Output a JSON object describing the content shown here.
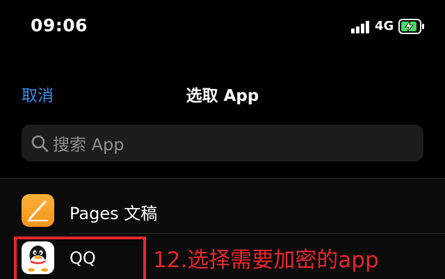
{
  "status_bar": {
    "time": "09:06",
    "network": "4G",
    "signal_bars": 4,
    "battery_state": "charging"
  },
  "nav": {
    "cancel_label": "取消",
    "title": "选取 App"
  },
  "search": {
    "placeholder": "搜索 App",
    "icon": "magnifier-icon"
  },
  "apps": [
    {
      "name": "Pages 文稿",
      "icon": "pages-app-icon"
    },
    {
      "name": "QQ",
      "icon": "qq-app-icon"
    }
  ],
  "annotation": {
    "text": "12.选择需要加密的app",
    "color": "#e8262d"
  },
  "colors": {
    "background": "#000000",
    "accent": "#3b8ef0",
    "search_bg": "#1c1c1e",
    "battery_green": "#4cd964"
  }
}
